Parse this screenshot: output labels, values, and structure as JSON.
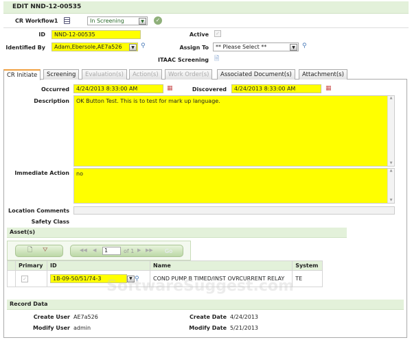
{
  "header": {
    "title": "EDIT NND-12-00535"
  },
  "workflow": {
    "label": "CR Workflow1",
    "status": "In Screening"
  },
  "fields": {
    "id_label": "ID",
    "id_value": "NND-12-00535",
    "active_label": "Active",
    "identified_by_label": "Identified By",
    "identified_by_value": "Adam,Ebersole,AE7a526",
    "assign_to_label": "Assign To",
    "assign_to_value": "** Please Select **",
    "itaac_label": "ITAAC Screening"
  },
  "tabs": [
    {
      "label": "CR Initiate"
    },
    {
      "label": "Screening"
    },
    {
      "label": "Evaluation(s)"
    },
    {
      "label": "Action(s)"
    },
    {
      "label": "Work Order(s)"
    },
    {
      "label": "Associated Document(s)"
    },
    {
      "label": "Attachment(s)"
    }
  ],
  "initiate": {
    "occurred_label": "Occurred",
    "occurred_value": "4/24/2013 8:33:00 AM",
    "discovered_label": "Discovered",
    "discovered_value": "4/24/2013 8:33:00 AM",
    "description_label": "Description",
    "description_value": "OK Button Test. This is to test for mark up language.",
    "immediate_label": "Immediate Action",
    "immediate_value": "no",
    "location_label": "Location Comments",
    "location_value": "",
    "safety_label": "Safety Class"
  },
  "assets": {
    "title": "Asset(s)",
    "pager": {
      "page": "1",
      "of": "of 1",
      "go": "Go"
    },
    "columns": [
      "Primary",
      "ID",
      "Name",
      "System"
    ],
    "rows": [
      {
        "id": "1B-09-50/51/74-3",
        "name": "COND PUMP B TIMED/INST OVRCURRENT RELAY",
        "system": "TE"
      }
    ]
  },
  "record": {
    "title": "Record Data",
    "create_user_label": "Create User",
    "create_user": "AE7a526",
    "modify_user_label": "Modify User",
    "modify_user": "admin",
    "create_date_label": "Create Date",
    "create_date": "4/24/2013",
    "modify_date_label": "Modify Date",
    "modify_date": "5/21/2013"
  },
  "watermark": "SoftwareSuggest.com"
}
